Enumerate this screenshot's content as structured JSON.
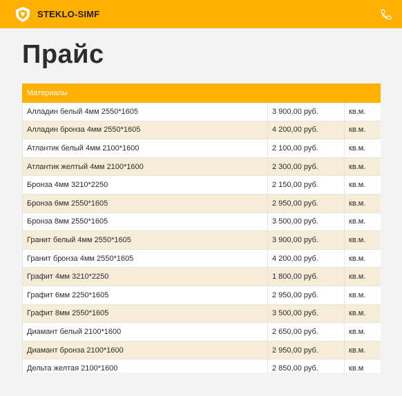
{
  "header": {
    "brand": "STEKLO-SIMF",
    "logo_icon": "shield-logo-icon",
    "phone_icon": "phone-icon",
    "accent_color": "#ffb000"
  },
  "page": {
    "title": "Прайс"
  },
  "table": {
    "header": "Материалы",
    "rows": [
      {
        "name": "Алладин белый 4мм 2550*1605",
        "price": "3 900,00 руб.",
        "unit": "кв.м."
      },
      {
        "name": "Алладин бронза 4мм 2550*1605",
        "price": "4 200,00 руб.",
        "unit": "кв.м."
      },
      {
        "name": "Атлантик белый 4мм 2100*1600",
        "price": "2 100,00 руб.",
        "unit": "кв.м."
      },
      {
        "name": "Атлантик желтый 4мм 2100*1600",
        "price": "2 300,00 руб.",
        "unit": "кв.м."
      },
      {
        "name": "Бронза 4мм 3210*2250",
        "price": "2 150,00 руб.",
        "unit": "кв.м."
      },
      {
        "name": "Бронза 6мм 2550*1605",
        "price": "2 950,00 руб.",
        "unit": "кв.м."
      },
      {
        "name": "Бронза 8мм 2550*1605",
        "price": "3 500,00 руб.",
        "unit": "кв.м."
      },
      {
        "name": "Гранит белый 4мм 2550*1605",
        "price": "3 900,00 руб.",
        "unit": "кв.м."
      },
      {
        "name": "Гранит бронза 4мм 2550*1605",
        "price": "4 200,00 руб.",
        "unit": "кв.м."
      },
      {
        "name": "Графит 4мм 3210*2250",
        "price": "1 800,00 руб.",
        "unit": "кв.м."
      },
      {
        "name": "Графит 6мм 2250*1605",
        "price": "2 950,00 руб.",
        "unit": "кв.м."
      },
      {
        "name": "Графит 8мм 2550*1605",
        "price": "3 500,00 руб.",
        "unit": "кв.м."
      },
      {
        "name": "Диамант белый 2100*1600",
        "price": "2 650,00 руб.",
        "unit": "кв.м."
      },
      {
        "name": "Диамант бронза 2100*1600",
        "price": "2 950,00 руб.",
        "unit": "кв.м."
      },
      {
        "name": "Дельта желтая 2100*1600",
        "price": "2 850,00 руб.",
        "unit": "кв.м"
      }
    ]
  }
}
